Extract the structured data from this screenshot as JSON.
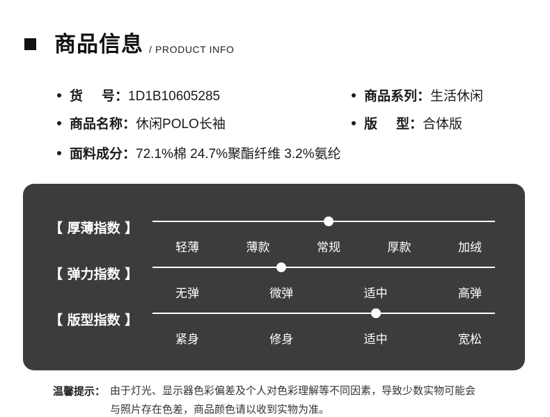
{
  "header": {
    "title": "商品信息",
    "subtitle": "/ PRODUCT INFO"
  },
  "info": {
    "item_no": {
      "label_a": "货",
      "label_b": "号",
      "sep": "：",
      "value": "1D1B10605285"
    },
    "series": {
      "label": "商品系列",
      "sep": "：",
      "value": "生活休闲"
    },
    "name": {
      "label": "商品名称",
      "sep": "：",
      "value": "休闲POLO长袖"
    },
    "fit": {
      "label_a": "版",
      "label_b": "型",
      "sep": "：",
      "value": "合体版"
    },
    "fabric": {
      "label": "面料成分",
      "sep": "：",
      "value": "72.1%棉 24.7%聚酯纤维 3.2%氨纶"
    }
  },
  "indices": [
    {
      "label": "【 厚薄指数 】",
      "options": [
        "轻薄",
        "薄款",
        "常规",
        "厚款",
        "加绒"
      ],
      "selected": 2
    },
    {
      "label": "【 弹力指数 】",
      "options": [
        "无弹",
        "微弹",
        "适中",
        "高弹"
      ],
      "selected": 1
    },
    {
      "label": "【 版型指数 】",
      "options": [
        "紧身",
        "修身",
        "适中",
        "宽松"
      ],
      "selected": 2
    }
  ],
  "note": {
    "label": "温馨提示：",
    "line1": "由于灯光、显示器色彩偏差及个人对色彩理解等不同因素，导致少数实物可能会",
    "line2": "与照片存在色差，商品颜色请以收到实物为准。"
  },
  "colors": {
    "panel_bg": "#3c3c3c",
    "text_dark": "#1a1a1a",
    "panel_text": "#ffffff"
  }
}
